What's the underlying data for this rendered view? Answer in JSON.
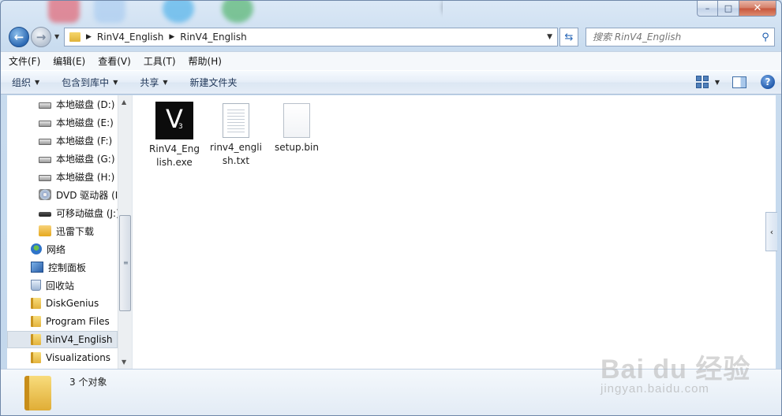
{
  "window": {
    "caption": {
      "minimize": "–",
      "maximize": "□",
      "close": "✕"
    }
  },
  "address": {
    "breadcrumbs": [
      "RinV4_English",
      "RinV4_English"
    ],
    "search_placeholder": "搜索 RinV4_English"
  },
  "menubar": [
    "文件(F)",
    "编辑(E)",
    "查看(V)",
    "工具(T)",
    "帮助(H)"
  ],
  "toolbar": {
    "organize": "组织",
    "include_in_library": "包含到库中",
    "share": "共享",
    "new_folder": "新建文件夹"
  },
  "navpane": {
    "items": [
      {
        "label": "本地磁盘 (D:)",
        "icon": "drive-icon"
      },
      {
        "label": "本地磁盘 (E:)",
        "icon": "drive-icon"
      },
      {
        "label": "本地磁盘 (F:)",
        "icon": "drive-icon"
      },
      {
        "label": "本地磁盘 (G:)",
        "icon": "drive-icon"
      },
      {
        "label": "本地磁盘 (H:)",
        "icon": "drive-icon"
      },
      {
        "label": "DVD 驱动器 (I",
        "icon": "dvd-icon"
      },
      {
        "label": "可移动磁盘 (J:)",
        "icon": "removable-disk-icon"
      },
      {
        "label": "迅雷下载",
        "icon": "xunlei-folder-icon"
      },
      {
        "label": "网络",
        "icon": "network-icon"
      },
      {
        "label": "控制面板",
        "icon": "control-panel-icon"
      },
      {
        "label": "回收站",
        "icon": "recycle-bin-icon"
      },
      {
        "label": "DiskGenius",
        "icon": "folder-icon"
      },
      {
        "label": "Program Files",
        "icon": "folder-icon"
      },
      {
        "label": "RinV4_English",
        "icon": "folder-icon",
        "selected": true
      },
      {
        "label": "Visualizations",
        "icon": "folder-icon"
      }
    ]
  },
  "files": [
    {
      "name": "RinV4_English.exe",
      "icon": "exe-icon",
      "glyph": "V",
      "sub": "3"
    },
    {
      "name": "rinv4_english.txt",
      "icon": "text-file-icon"
    },
    {
      "name": "setup.bin",
      "icon": "blank-file-icon"
    }
  ],
  "details": {
    "count_text": "3 个对象"
  },
  "watermark": {
    "logo": "Bai du 经验",
    "url": "jingyan.baidu.com"
  },
  "colors": {
    "selection": "#dfe6ee",
    "toolbar_text": "#1e3557",
    "accent": "#2d6ab4"
  }
}
